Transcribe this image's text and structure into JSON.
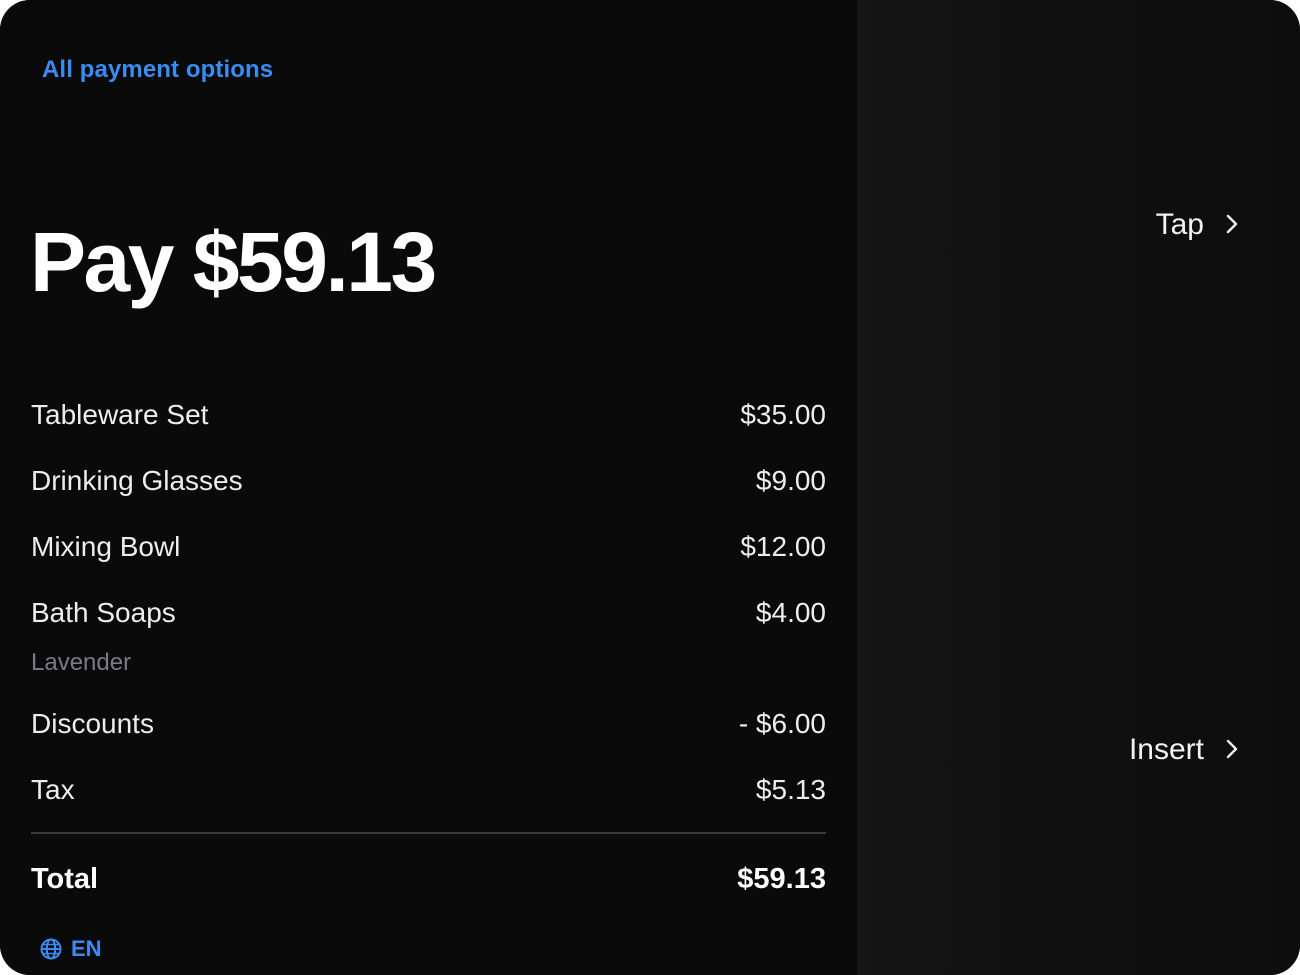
{
  "header": {
    "all_payment_options": "All payment options"
  },
  "summary": {
    "pay_label": "Pay $59.13"
  },
  "line_items": [
    {
      "name": "Tableware Set",
      "amount": "$35.00"
    },
    {
      "name": "Drinking Glasses",
      "amount": "$9.00"
    },
    {
      "name": "Mixing Bowl",
      "amount": "$12.00"
    },
    {
      "name": "Bath Soaps",
      "amount": "$4.00",
      "modifier": "Lavender"
    },
    {
      "name": "Discounts",
      "amount": "- $6.00"
    },
    {
      "name": "Tax",
      "amount": "$5.13"
    }
  ],
  "total": {
    "label": "Total",
    "amount": "$59.13"
  },
  "language": {
    "code": "EN",
    "icon": "globe-icon"
  },
  "payment_methods": [
    {
      "label": "Tap",
      "icon": "chevron-right-icon"
    },
    {
      "label": "Insert",
      "icon": "chevron-right-icon"
    }
  ],
  "colors": {
    "accent": "#3b8cf2",
    "background": "#0a0a0a",
    "text": "#ffffff",
    "muted": "#777c84"
  }
}
